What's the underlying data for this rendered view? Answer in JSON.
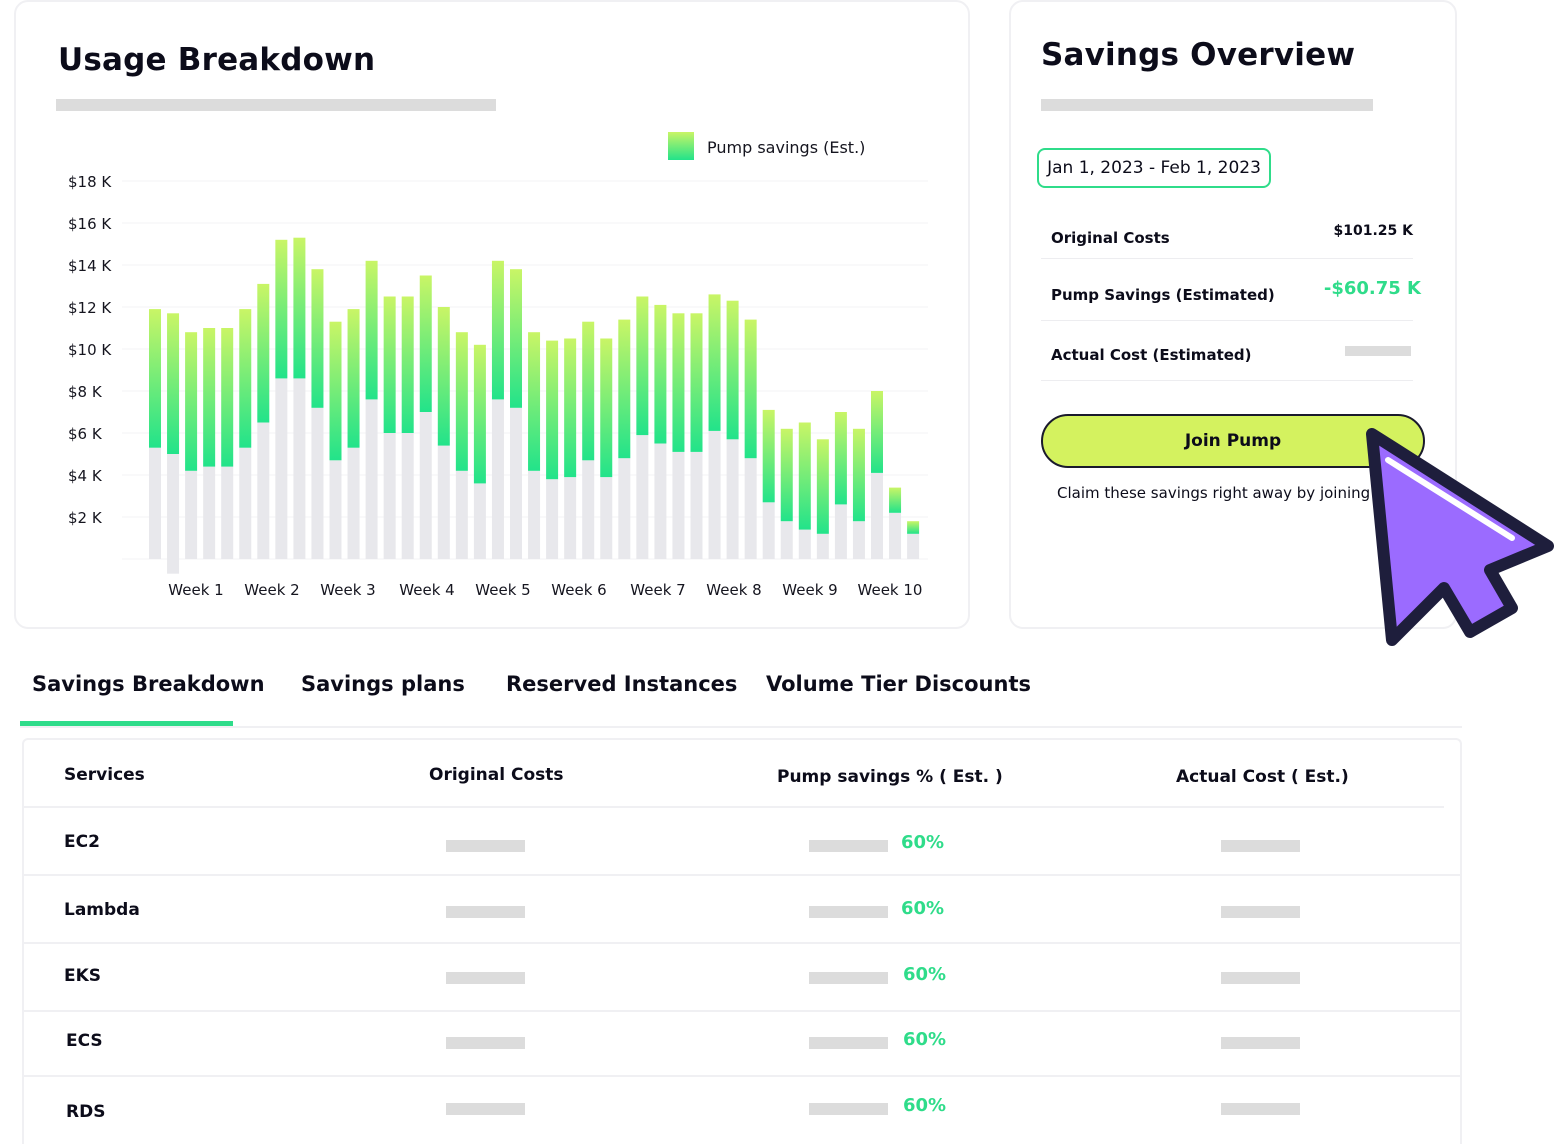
{
  "usage": {
    "title": "Usage Breakdown",
    "legend_label": "Pump savings (Est.)"
  },
  "chart_data": {
    "type": "bar",
    "stacked": true,
    "y_ticks": [
      "$18 K",
      "$16 K",
      "$14 K",
      "$12 K",
      "$10 K",
      "$8 K",
      "$6 K",
      "$4 K",
      "$2 K"
    ],
    "ylim": [
      0,
      18
    ],
    "week_labels": [
      "Week 1",
      "Week 2",
      "Week 3",
      "Week 4",
      "Week 5",
      "Week 6",
      "Week 7",
      "Week 8",
      "Week 9",
      "Week 10"
    ],
    "series": [
      {
        "name": "Base",
        "color": "#e8e8ec",
        "values": [
          5.3,
          5.0,
          4.2,
          4.4,
          4.4,
          5.3,
          6.5,
          8.6,
          8.6,
          7.2,
          4.7,
          5.3,
          7.6,
          6.0,
          6.0,
          7.0,
          5.4,
          4.2,
          3.6,
          7.6,
          7.2,
          4.2,
          3.8,
          3.9,
          4.7,
          3.9,
          4.8,
          5.9,
          5.5,
          5.1,
          5.1,
          6.1,
          5.7,
          4.8,
          2.7,
          1.8,
          1.4,
          1.2,
          2.6,
          1.8,
          4.1,
          2.2,
          1.2
        ],
        "dip_index": 1,
        "dip_value": -0.7
      },
      {
        "name": "Pump savings (Est.)",
        "color_top": "#c9f566",
        "color_bottom": "#22e38a",
        "values": [
          6.6,
          6.7,
          6.6,
          6.6,
          6.6,
          6.6,
          6.6,
          6.6,
          6.7,
          6.6,
          6.6,
          6.6,
          6.6,
          6.5,
          6.5,
          6.5,
          6.6,
          6.6,
          6.6,
          6.6,
          6.6,
          6.6,
          6.6,
          6.6,
          6.6,
          6.6,
          6.6,
          6.6,
          6.6,
          6.6,
          6.6,
          6.5,
          6.6,
          6.6,
          4.4,
          4.4,
          5.1,
          4.5,
          4.4,
          4.4,
          3.9,
          1.2,
          0.6
        ]
      }
    ]
  },
  "overview": {
    "title": "Savings Overview",
    "date_range": "Jan 1, 2023 - Feb 1, 2023",
    "rows": [
      {
        "label": "Original Costs",
        "value": "$101.25 K"
      },
      {
        "label": "Pump Savings (Estimated)",
        "value": "-$60.75 K"
      },
      {
        "label": "Actual Cost  (Estimated)",
        "value": ""
      }
    ],
    "join_label": "Join Pump",
    "claim_text": "Claim these savings right away by joining"
  },
  "tabs": [
    "Savings Breakdown",
    "Savings plans",
    "Reserved Instances",
    "Volume Tier Discounts"
  ],
  "table": {
    "headers": [
      "Services",
      "Original Costs",
      "Pump savings % ( Est. )",
      "Actual Cost ( Est.)"
    ],
    "rows": [
      {
        "service": "EC2",
        "pct": "60%"
      },
      {
        "service": "Lambda",
        "pct": "60%"
      },
      {
        "service": "EKS",
        "pct": "60%"
      },
      {
        "service": "ECS",
        "pct": "60%"
      },
      {
        "service": "RDS",
        "pct": "60%"
      }
    ]
  },
  "colors": {
    "accent_green": "#2fdc8a",
    "button_lime": "#d4f25f",
    "cursor_purple": "#9b6bff",
    "cursor_outline": "#1e1e3c"
  }
}
